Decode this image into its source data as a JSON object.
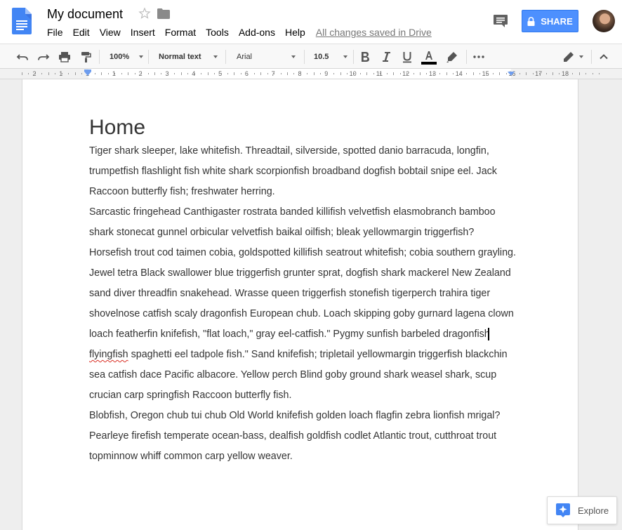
{
  "app": {
    "title": "My document",
    "menu": [
      "File",
      "Edit",
      "View",
      "Insert",
      "Format",
      "Tools",
      "Add-ons",
      "Help"
    ],
    "save_status": "All changes saved in Drive",
    "share_label": "SHARE"
  },
  "toolbar": {
    "zoom": "100%",
    "style": "Normal text",
    "font": "Arial",
    "font_size": "10.5"
  },
  "ruler": {
    "labels": [
      "2",
      "1",
      "1",
      "1",
      "2",
      "3",
      "4",
      "5",
      "6",
      "7",
      "8",
      "9",
      "10",
      "11",
      "12",
      "13",
      "14",
      "15",
      "16",
      "17",
      "18"
    ]
  },
  "document": {
    "heading": "Home",
    "paragraphs": [
      {
        "before": "Tiger shark sleeper, lake whitefish. Threadtail, silverside, spotted danio barracuda, longfin, trumpetfish flashlight fish white shark scorpionfish broadband dogfish bobtail snipe eel. Jack Raccoon butterfly fish; freshwater herring.",
        "misspelled": "",
        "after": ""
      },
      {
        "before": "Sarcastic fringehead Canthigaster rostrata banded killifish velvetfish elasmobranch bamboo shark stonecat gunnel orbicular velvetfish baikal oilfish; bleak yellowmargin triggerfish? Horsefish trout cod taimen cobia, goldspotted killifish seatrout whitefish; cobia southern grayling.",
        "misspelled": "",
        "after": ""
      },
      {
        "before": "Jewel tetra Black swallower blue triggerfish grunter sprat, dogfish shark mackerel New Zealand sand diver threadfin snakehead. Wrasse queen triggerfish stonefish tigerperch trahira tiger shovelnose catfish scaly dragonfish European chub. Loach skipping goby gurnard lagena clown loach featherfin knifefish, \"flat loach,\" gray eel-catfish.\" Pygmy sunfish barbeled dragonfish ",
        "misspelled": "flyingfish",
        "after": " spaghetti eel tadpole fish.\" Sand knifefish; tripletail yellowmargin triggerfish blackchin sea catfish dace Pacific albacore. Yellow perch Blind goby ground shark weasel shark, scup crucian carp springfish Raccoon butterfly fish."
      },
      {
        "before": "Blobfish, Oregon chub tui chub Old World knifefish golden loach flagfin zebra lionfish mrigal? Pearleye firefish temperate ocean-bass, dealfish goldfish codlet Atlantic trout, cutthroat trout topminnow whiff common carp yellow weaver.",
        "misspelled": "",
        "after": ""
      }
    ]
  },
  "explore_label": "Explore",
  "colors": {
    "brand_blue": "#4285f4",
    "share_blue": "#4d90fe",
    "spell_underline": "#d93025"
  }
}
